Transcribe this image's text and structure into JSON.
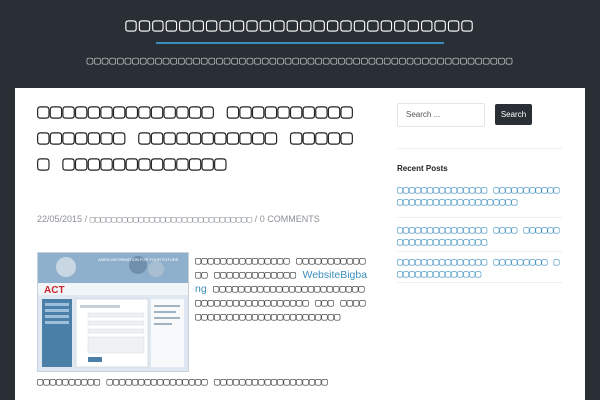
{
  "header": {
    "site_title": "▢▢▢▢▢▢▢▢▢▢▢▢▢▢▢▢▢▢▢▢▢▢▢▢▢▢",
    "site_description": "▢▢▢▢▢▢▢▢▢▢▢▢▢▢▢▢▢▢▢▢▢▢▢▢▢▢▢▢▢▢▢▢▢▢▢▢▢▢▢▢▢▢▢▢▢▢▢▢▢▢▢▢▢▢▢▢"
  },
  "post": {
    "title": "▢▢▢▢▢▢▢▢▢▢▢▢▢▢ ▢▢▢▢▢▢▢▢▢▢▢▢▢▢▢▢▢ ▢▢▢▢▢▢▢▢▢▢▢ ▢▢▢▢▢▢ ▢▢▢▢▢▢▢▢▢▢▢▢▢",
    "date": "22/05/2015",
    "separator": "/",
    "category": "▢▢▢▢▢▢▢▢▢▢▢▢▢▢▢▢▢▢▢▢▢▢▢▢▢▢▢▢▢▢",
    "comments": "0 COMMENTS",
    "excerpt_before": "▢▢▢▢▢▢▢▢▢▢▢▢▢▢▢ ▢▢▢▢▢▢▢▢▢▢▢▢▢ ▢▢▢▢▢▢▢▢▢▢▢▢▢",
    "excerpt_link": "WebsiteBigbang",
    "excerpt_after": "▢▢▢▢▢▢▢▢▢▢▢▢▢▢▢▢▢▢▢▢▢▢▢▢▢▢▢▢▢▢▢▢▢▢▢▢▢▢▢▢▢▢ ▢▢▢ ▢▢▢▢▢▢▢▢▢▢▢▢▢▢▢▢▢▢▢▢▢▢▢▢▢▢▢",
    "excerpt_tail": "▢▢▢▢▢▢▢▢▢▢ ▢▢▢▢▢▢▢▢▢▢▢▢▢▢▢▢ ▢▢▢▢▢▢▢▢▢▢▢▢▢▢▢▢▢▢"
  },
  "thumbnail": {
    "logo_text": "ACT",
    "banner_text": "ANEW INFORMATION FOR YOUR FUTURE"
  },
  "sidebar": {
    "search_placeholder": "Search ...",
    "search_button": "Search",
    "recent_posts_title": "Recent Posts",
    "recent_posts": [
      "▢▢▢▢▢▢▢▢▢▢▢▢▢▢▢ ▢▢▢▢▢▢▢▢▢▢▢▢▢▢▢▢▢▢▢▢▢▢▢▢▢▢▢▢▢▢▢",
      "▢▢▢▢▢▢▢▢▢▢▢▢▢▢▢ ▢▢▢▢ ▢▢▢▢▢▢ ▢▢▢▢▢▢▢▢▢▢▢▢▢▢▢",
      "▢▢▢▢▢▢▢▢▢▢▢▢▢▢▢ ▢▢▢▢▢▢▢▢▢ ▢▢▢▢▢▢▢▢▢▢▢▢▢▢▢"
    ]
  },
  "colors": {
    "header_bg": "#2a2f35",
    "accent": "#3b8dbd"
  }
}
